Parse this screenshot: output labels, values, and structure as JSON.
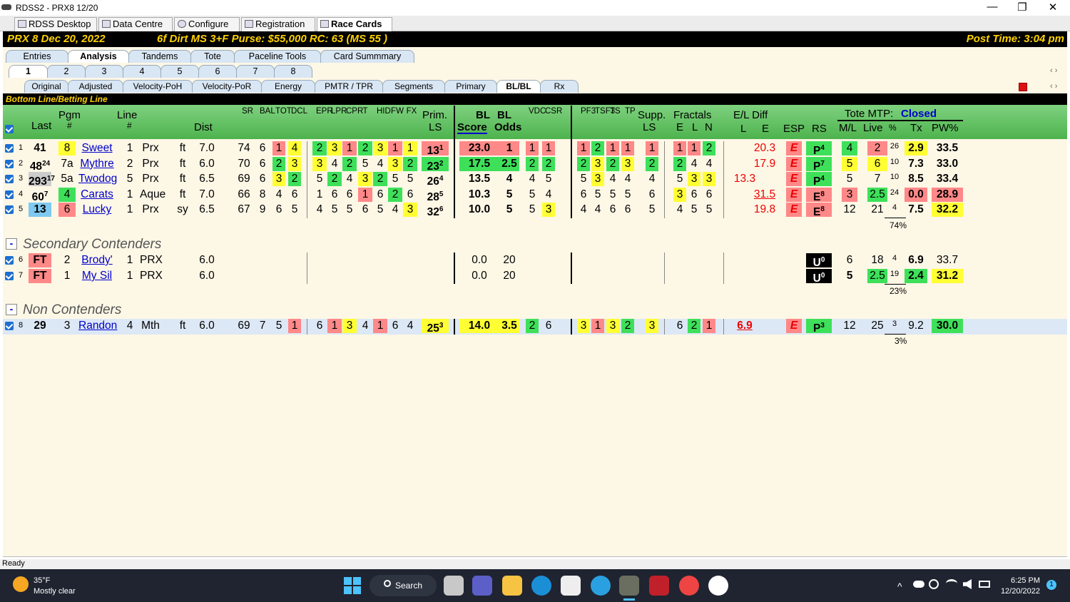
{
  "window": {
    "title": "RDSS2 - PRX8  12/20",
    "min": "—",
    "max": "❐",
    "close": "✕"
  },
  "app_tabs": [
    "RDSS Desktop",
    "Data Centre",
    "Configure",
    "Registration",
    "Race Cards"
  ],
  "race_header": {
    "left": "PRX  8   Dec 20, 2022",
    "mid": "6f  Dirt   MS  3+F   Purse: $55,000   RC: 63  (MS 55 )",
    "right": "Post Time: 3:04 pm"
  },
  "main_tabs": [
    "Entries",
    "Analysis",
    "Tandems",
    "Tote",
    "Paceline Tools",
    "Card Summmary"
  ],
  "num_tabs": [
    "1",
    "2",
    "3",
    "4",
    "5",
    "6",
    "7",
    "8"
  ],
  "sub_tabs": [
    "Original",
    "Adjusted",
    "Velocity-PoH",
    "Velocity-PoR",
    "Energy",
    "PMTR / TPR",
    "Segments",
    "Primary",
    "BL/BL",
    "Rx"
  ],
  "section_title": "Bottom Line/Betting Line",
  "nav_arrows": "‹ ›",
  "headers": {
    "last": "Last",
    "pgm": "Pgm",
    "pgm_hash": "#",
    "line": "Line",
    "line_hash": "#",
    "dist": "Dist",
    "prim": "Prim.",
    "ls": "LS",
    "bl1": "BL",
    "bl2": "BL",
    "score": "Score",
    "odds": "Odds",
    "supp": "Supp.",
    "supp_ls": "LS",
    "fractals": "Fractals",
    "frac_e": "E",
    "frac_l": "L",
    "frac_n": "N",
    "eldiff": "E/L Diff",
    "el_l": "L",
    "el_e": "E",
    "esp": "ESP",
    "rs": "RS",
    "tote": "Tote MTP:",
    "tote_status": "Closed",
    "ml": "M/L",
    "live": "Live",
    "pcnt": "%",
    "tx": "Tx",
    "pw": "PW%"
  },
  "stacked": {
    "sr": "SR",
    "bal": "BAL",
    "tot": "TOT",
    "dcl": "DCL",
    "epr": "EPR",
    "lpr": "LPR",
    "cpr": "CPR",
    "tt": "T",
    "hid": "HID",
    "fw": "FW",
    "fx": "FX",
    "vdc": "VDC",
    "csr": "CSR",
    "pf3": "PF3",
    "tsf3": "TSF3",
    "ts": "TS",
    "tp": "TP"
  },
  "rows": [
    {
      "n": "1",
      "last": "41",
      "pgm": "8",
      "name": "Sweet",
      "line": "1",
      "trk": "Prx",
      "surf": "ft",
      "dist": "7.0",
      "sr": "74",
      "bal": "6",
      "tot": "1",
      "dcl": "4",
      "e": "2",
      "l": "3",
      "c": "1",
      "t": "2",
      "h": "3",
      "f": "1",
      "x": "1",
      "prim": "13",
      "primsup": "1",
      "score": "23.0",
      "odds": "1",
      "v": "1",
      "cs": "1",
      "p1": "1",
      "p2": "2",
      "p3": "1",
      "p4": "1",
      "supp": "1",
      "fe": "1",
      "fl": "1",
      "fn": "2",
      "ell": "",
      "ele": "20.3",
      "esp": "E",
      "rs": "P",
      "rssup": "4",
      "ml": "4",
      "live": "2",
      "pct": "26",
      "tx": "2.9",
      "pw": "33.5"
    },
    {
      "n": "2",
      "last": "48",
      "lastsup": "24",
      "pgm": "7a",
      "name": "Mythre",
      "line": "2",
      "trk": "Prx",
      "surf": "ft",
      "dist": "6.0",
      "sr": "70",
      "bal": "6",
      "tot": "2",
      "dcl": "3",
      "e": "3",
      "l": "4",
      "c": "2",
      "t": "5",
      "h": "4",
      "f": "3",
      "x": "2",
      "prim": "23",
      "primsup": "2",
      "score": "17.5",
      "odds": "2.5",
      "v": "2",
      "cs": "2",
      "p1": "2",
      "p2": "3",
      "p3": "2",
      "p4": "3",
      "supp": "2",
      "fe": "2",
      "fl": "4",
      "fn": "4",
      "ell": "",
      "ele": "17.9",
      "esp": "E",
      "rs": "P",
      "rssup": "7",
      "ml": "5",
      "live": "6",
      "pct": "10",
      "tx": "7.3",
      "pw": "33.0"
    },
    {
      "n": "3",
      "last": "293",
      "lastsup": "17",
      "pgm": "5a",
      "name": "Twodog",
      "line": "5",
      "trk": "Prx",
      "surf": "ft",
      "dist": "6.5",
      "sr": "69",
      "bal": "6",
      "tot": "3",
      "dcl": "2",
      "e": "5",
      "l": "2",
      "c": "4",
      "t": "3",
      "h": "2",
      "f": "5",
      "x": "5",
      "prim": "26",
      "primsup": "4",
      "score": "13.5",
      "odds": "4",
      "v": "4",
      "cs": "5",
      "p1": "5",
      "p2": "3",
      "p3": "4",
      "p4": "4",
      "supp": "4",
      "fe": "5",
      "fl": "3",
      "fn": "3",
      "ell": "13.3",
      "ele": "",
      "esp": "E",
      "rs": "P",
      "rssup": "4",
      "ml": "5",
      "live": "7",
      "pct": "10",
      "tx": "8.5",
      "pw": "33.4"
    },
    {
      "n": "4",
      "last": "60",
      "lastsup": "7",
      "pgm": "4",
      "name": "Carats",
      "line": "1",
      "trk": "Aque",
      "surf": "ft",
      "dist": "7.0",
      "sr": "66",
      "bal": "8",
      "tot": "4",
      "dcl": "6",
      "e": "1",
      "l": "6",
      "c": "6",
      "t": "1",
      "h": "6",
      "f": "2",
      "x": "6",
      "prim": "28",
      "primsup": "5",
      "score": "10.3",
      "odds": "5",
      "v": "5",
      "cs": "4",
      "p1": "6",
      "p2": "5",
      "p3": "5",
      "p4": "5",
      "supp": "6",
      "fe": "3",
      "fl": "6",
      "fn": "6",
      "ell": "",
      "ele": "31.5",
      "esp": "E",
      "rs": "E",
      "rssup": "8",
      "ml": "3",
      "live": "2.5",
      "pct": "24",
      "tx": "0.0",
      "pw": "28.9"
    },
    {
      "n": "5",
      "last": "13",
      "pgm": "6",
      "name": "Lucky",
      "line": "1",
      "trk": "Prx",
      "surf": "sy",
      "dist": "6.5",
      "sr": "67",
      "bal": "9",
      "tot": "6",
      "dcl": "5",
      "e": "4",
      "l": "5",
      "c": "5",
      "t": "6",
      "h": "5",
      "f": "4",
      "x": "3",
      "prim": "32",
      "primsup": "6",
      "score": "10.0",
      "odds": "5",
      "v": "5",
      "cs": "3",
      "p1": "4",
      "p2": "4",
      "p3": "6",
      "p4": "6",
      "supp": "5",
      "fe": "4",
      "fl": "5",
      "fn": "5",
      "ell": "",
      "ele": "19.8",
      "esp": "E",
      "rs": "E",
      "rssup": "8",
      "ml": "12",
      "live": "21",
      "pct": "4",
      "tx": "7.5",
      "pw": "32.2"
    }
  ],
  "pct_total_1": "74%",
  "sec_secondary": "Secondary Contenders",
  "sec_non": "Non Contenders",
  "minus": "-",
  "rows2": [
    {
      "n": "6",
      "last": "FT",
      "pgm": "2",
      "name": "Brody'",
      "line": "1",
      "trk": "PRX",
      "dist": "6.0",
      "score": "0.0",
      "odds": "20",
      "rs": "U",
      "rssup": "0",
      "ml": "6",
      "live": "18",
      "pct": "4",
      "tx": "6.9",
      "pw": "33.7"
    },
    {
      "n": "7",
      "last": "FT",
      "pgm": "1",
      "name": "My Sil",
      "line": "1",
      "trk": "PRX",
      "dist": "6.0",
      "score": "0.0",
      "odds": "20",
      "rs": "U",
      "rssup": "0",
      "ml": "5",
      "live": "2.5",
      "pct": "19",
      "tx": "2.4",
      "pw": "31.2"
    }
  ],
  "pct_total_2": "23%",
  "row3": {
    "n": "8",
    "last": "29",
    "pgm": "3",
    "name": "Randon",
    "line": "4",
    "trk": "Mth",
    "surf": "ft",
    "dist": "6.0",
    "sr": "69",
    "bal": "7",
    "tot": "5",
    "dcl": "1",
    "e": "6",
    "l": "1",
    "c": "3",
    "t": "4",
    "h": "1",
    "f": "6",
    "x": "4",
    "prim": "25",
    "primsup": "3",
    "score": "14.0",
    "odds": "3.5",
    "v": "2",
    "cs": "6",
    "p1": "3",
    "p2": "1",
    "p3": "3",
    "p4": "2",
    "supp": "3",
    "fe": "6",
    "fl": "2",
    "fn": "1",
    "ell": "6.9",
    "esp": "E",
    "rs": "P",
    "rssup": "3",
    "ml": "12",
    "live": "25",
    "pct": "3",
    "tx": "9.2",
    "pw": "30.0"
  },
  "pct_total_3": "3%",
  "status": "Ready",
  "taskbar": {
    "temp": "35°F",
    "weather": "Mostly clear",
    "search": "Search",
    "time": "6:25 PM",
    "date": "12/20/2022",
    "notif": "1"
  }
}
